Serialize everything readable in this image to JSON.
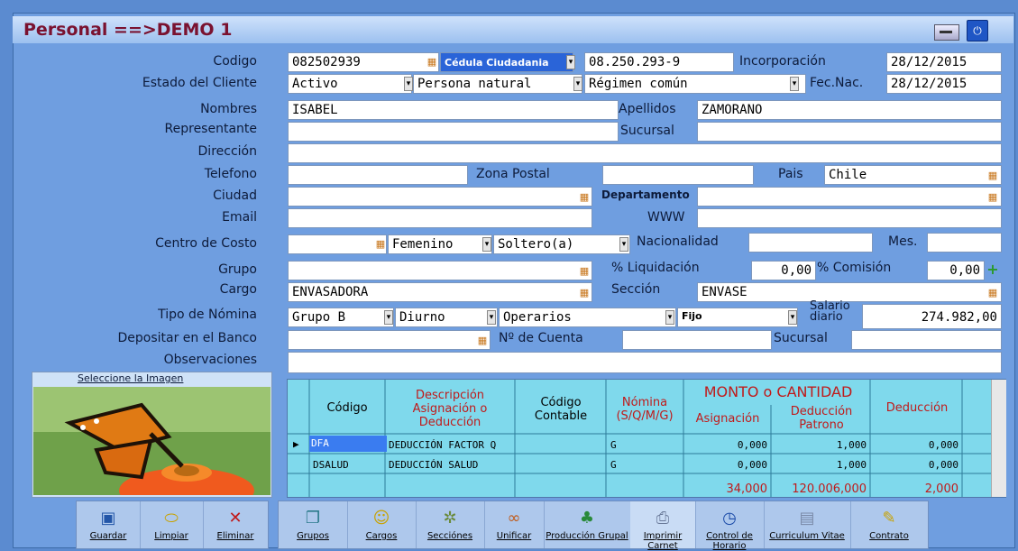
{
  "window": {
    "title": "Personal ==>DEMO 1",
    "power_glyph": "⏻"
  },
  "labels": {
    "codigo": "Codigo",
    "estado": "Estado del Cliente",
    "nombres": "Nombres",
    "representante": "Representante",
    "direccion": "Dirección",
    "telefono": "Telefono",
    "ciudad": "Ciudad",
    "email": "Email",
    "centro_costo": "Centro de Costo",
    "grupo": "Grupo",
    "cargo": "Cargo",
    "tipo_nomina": "Tipo de Nómina",
    "depositar": "Depositar en el Banco",
    "observaciones": "Observaciones",
    "incorporacion": "Incorporación",
    "fec_nac": "Fec.Nac.",
    "apellidos": "Apellidos",
    "sucursal": "Sucursal",
    "zona_postal": "Zona Postal",
    "pais": "Pais",
    "departamento": "Departamento",
    "www": "WWW",
    "nacionalidad": "Nacionalidad",
    "mes": "Mes.",
    "pct_liquidacion": "% Liquidación",
    "pct_comision": "% Comisión",
    "seccion": "Sección",
    "salario": "Salario diario",
    "no_cuenta": "Nº de Cuenta",
    "sucursal2": "Sucursal"
  },
  "fields": {
    "codigo": "082502939",
    "tipo_doc": "Cédula Ciudadania",
    "num_doc": "08.250.293-9",
    "incorporacion": "28/12/2015",
    "estado": "Activo",
    "tipo_persona": "Persona natural",
    "regimen": "Régimen común",
    "fec_nac": "28/12/2015",
    "nombres": "ISABEL",
    "apellidos": "ZAMORANO",
    "pais": "Chile",
    "genero": "Femenino",
    "estado_civil": "Soltero(a)",
    "liquidacion": "0,00",
    "comision": "0,00",
    "cargo": "ENVASADORA",
    "seccion": "ENVASE",
    "nomina_grupo": "Grupo B",
    "jornada": "Diurno",
    "categoria": "Operarios",
    "contrato": "Fijo",
    "salario": "274.982,00"
  },
  "image_panel": {
    "title": "Seleccione la Imagen"
  },
  "grid": {
    "headers": {
      "codigo": "Código",
      "descripcion": "Descripción Asignación o Deducción",
      "contable": "Código Contable",
      "nomina": "Nómina (S/Q/M/G)",
      "monto": "MONTO o CANTIDAD",
      "asignacion": "Asignación",
      "deduccion_patrono": "Deducción Patrono",
      "deduccion": "Deducción"
    },
    "rows": [
      {
        "codigo": "DFA",
        "descripcion": "DEDUCCIÓN FACTOR Q",
        "nomina": "G",
        "asignacion": "0,000",
        "patrono": "1,000",
        "deduccion": "0,000"
      },
      {
        "codigo": "DSALUD",
        "descripcion": "DEDUCCIÓN SALUD",
        "nomina": "G",
        "asignacion": "0,000",
        "patrono": "1,000",
        "deduccion": "0,000"
      }
    ],
    "totals": {
      "asignacion": "34,000",
      "patrono": "120.006,000",
      "deduccion": "2,000"
    }
  },
  "toolbar": {
    "guardar": "Guardar",
    "limpiar": "Limpiar",
    "eliminar": "Eliminar",
    "grupos": "Grupos",
    "cargos": "Cargos",
    "secciones": "Secciónes",
    "unificar": "Unificar",
    "produccion": "Producción Grupal",
    "imprimir": "Imprimir Carnet",
    "control": "Control de Horario",
    "curriculum": "Curriculum Vitae",
    "contrato": "Contrato"
  }
}
